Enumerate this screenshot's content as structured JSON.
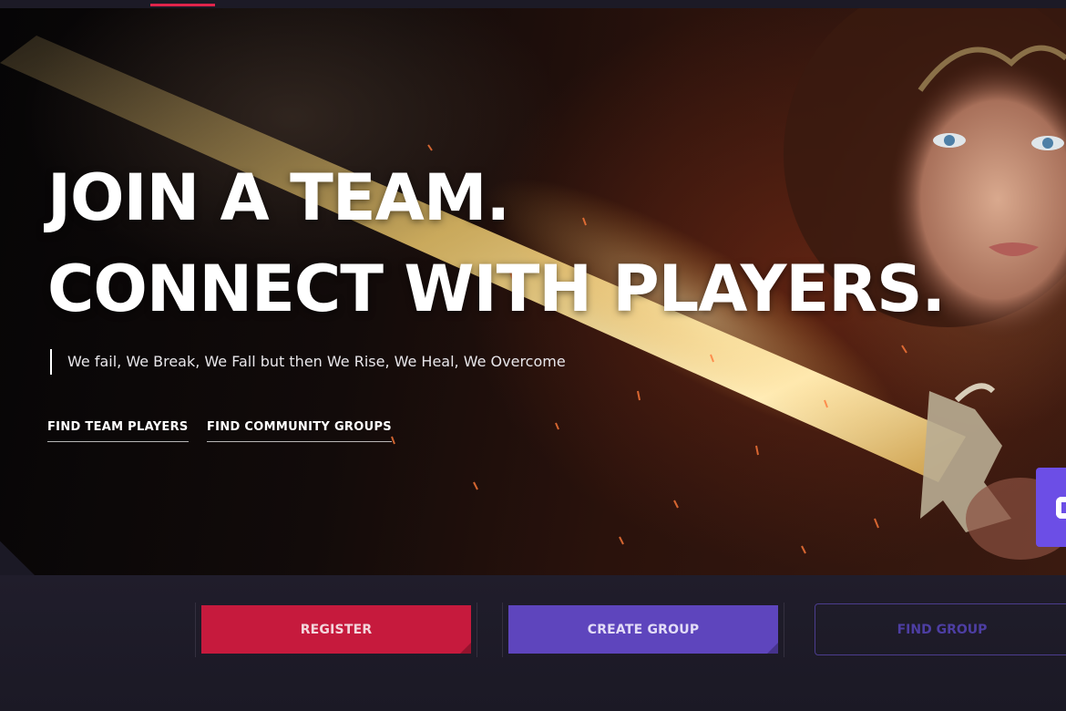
{
  "hero": {
    "headline_line1": "JOIN A TEAM.",
    "headline_line2": "CONNECT WITH PLAYERS.",
    "tagline": "We fail, We Break, We Fall but then We Rise, We Heal, We Overcome",
    "links": {
      "find_team_players": "FIND TEAM PLAYERS",
      "find_community_groups": "FIND COMMUNITY GROUPS"
    }
  },
  "actions": {
    "register": "REGISTER",
    "create_group": "CREATE GROUP",
    "find_group": "FIND GROUP"
  },
  "colors": {
    "accent_red": "#e0244b",
    "register_bg": "#c61a3d",
    "create_bg": "#5e45bd",
    "side_tab": "#6c4ee6",
    "page_bg": "#1b1925"
  },
  "icons": {
    "side_tab": "chat-icon"
  }
}
